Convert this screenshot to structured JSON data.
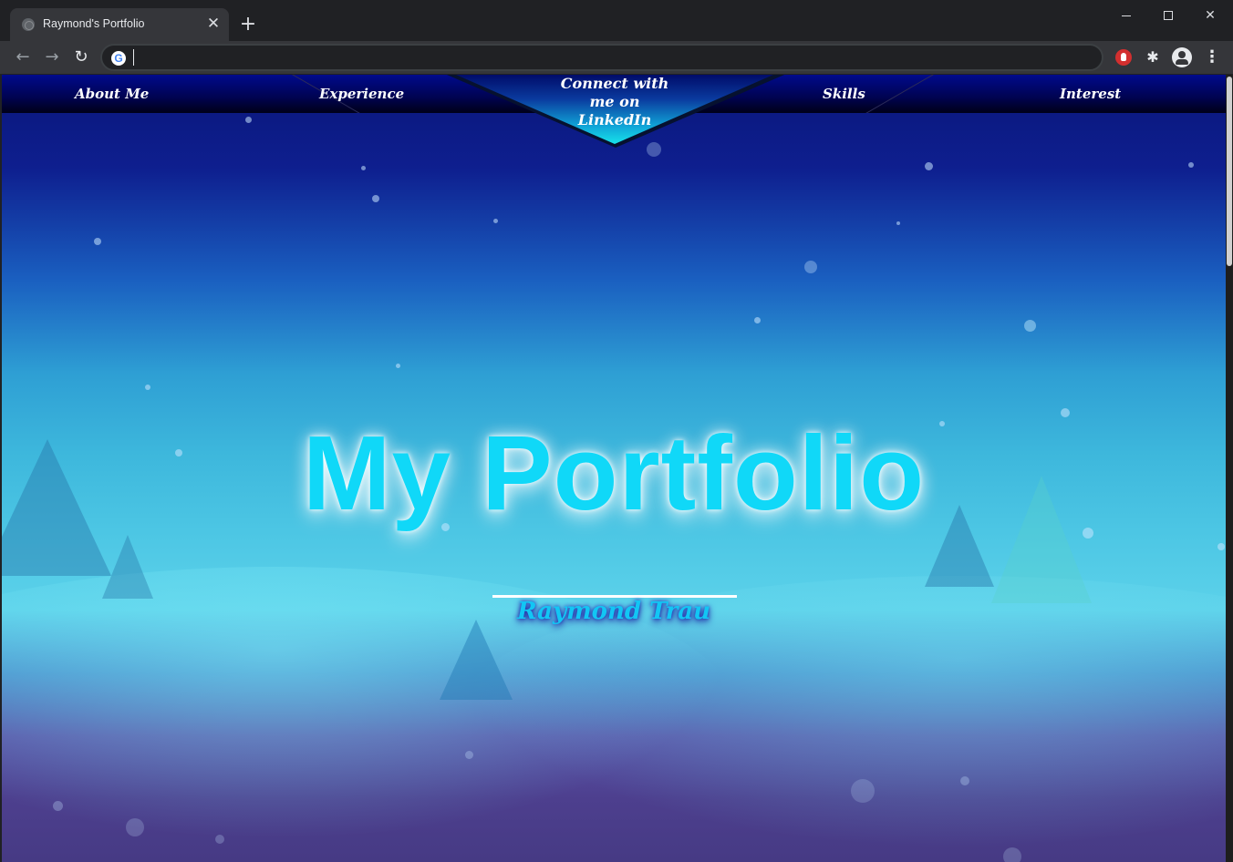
{
  "browser": {
    "tab_title": "Raymond's Portfolio",
    "tab_close": "✕",
    "new_tab": "+",
    "address_value": "",
    "google_icon_letter": "G",
    "window_buttons": {
      "minimize": "",
      "maximize": "",
      "close": "✕"
    },
    "nav": {
      "back": "←",
      "forward": "→",
      "reload": "↻"
    },
    "extensions": {
      "puzzle": "✱",
      "menu": "⋮"
    }
  },
  "page": {
    "nav": {
      "about": "About Me",
      "experience": "Experience",
      "linkedin": "Connect with me on LinkedIn",
      "skills": "Skills",
      "interest": "Interest"
    },
    "hero": {
      "title": "My Portfolio",
      "name": "Raymond Trau"
    }
  },
  "colors": {
    "title_cyan": "#10d8f8",
    "nav_bg": "#000350",
    "linkedin_accent": "#1ad0e0",
    "chrome_dark": "#202124"
  }
}
